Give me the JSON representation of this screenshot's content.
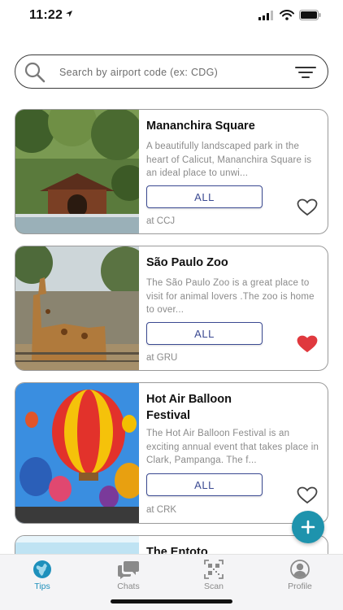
{
  "status_bar": {
    "time": "11:22"
  },
  "search": {
    "placeholder": "Search by airport code (ex: CDG)"
  },
  "cards": [
    {
      "title": "Mananchira Square",
      "description": "A beautifully landscaped park in the heart of Calicut, Mananchira Square is an ideal place to unwi...",
      "button_label": "ALL",
      "airport": "at CCJ",
      "favorited": false
    },
    {
      "title": "São Paulo Zoo",
      "description": "The São Paulo Zoo is a great place to visit for animal lovers .The zoo is home to over...",
      "button_label": "ALL",
      "airport": "at GRU",
      "favorited": true
    },
    {
      "title": "Hot Air Balloon Festival",
      "description": "The Hot Air Balloon Festival is an exciting annual event that takes place in Clark, Pampanga. The f...",
      "button_label": "ALL",
      "airport": "at CRK",
      "favorited": false
    },
    {
      "title": "The Entoto"
    }
  ],
  "fab": {
    "icon": "plus-icon"
  },
  "tabs": [
    {
      "label": "Tips",
      "icon": "globe-icon",
      "active": true
    },
    {
      "label": "Chats",
      "icon": "chat-bubbles-icon",
      "active": false
    },
    {
      "label": "Scan",
      "icon": "qr-code-icon",
      "active": false
    },
    {
      "label": "Profile",
      "icon": "user-icon",
      "active": false
    }
  ],
  "colors": {
    "accent": "#1e93ad",
    "button_border": "#3b4a92",
    "heart_active": "#e0393e",
    "tab_active": "#1e90bc",
    "muted_text": "#8a8a8a"
  }
}
